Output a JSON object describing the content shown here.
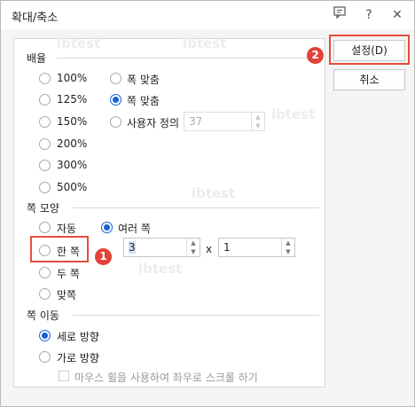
{
  "window": {
    "title": "확대/축소"
  },
  "titlebar": {
    "help_symbol": "?",
    "close_symbol": "✕"
  },
  "magnification": {
    "section_title": "배율",
    "percent_options": [
      "100%",
      "125%",
      "150%",
      "200%",
      "300%",
      "500%"
    ],
    "fit_width_label": "폭 맞춤",
    "fit_page_label": "쪽 맞춤",
    "custom_label": "사용자 정의",
    "custom_value": "37"
  },
  "page_layout": {
    "section_title": "쪽 모양",
    "auto_label": "자동",
    "multi_label": "여러 쪽",
    "single_label": "한 쪽",
    "two_label": "두 쪽",
    "facing_label": "맞쪽",
    "columns_value": "3",
    "times_symbol": "x",
    "rows_value": "1"
  },
  "page_move": {
    "section_title": "쪽 이동",
    "vertical_label": "세로 방향",
    "horizontal_label": "가로 방향",
    "wheel_label": "마우스 휠을 사용하여 좌우로 스크롤 하기"
  },
  "buttons": {
    "ok_label": "설정(D)",
    "cancel_label": "취소"
  },
  "annotations": {
    "badge_1": "1",
    "badge_2": "2",
    "accent_color": "#e74c3c"
  },
  "watermark": {
    "text": "ibtest"
  }
}
